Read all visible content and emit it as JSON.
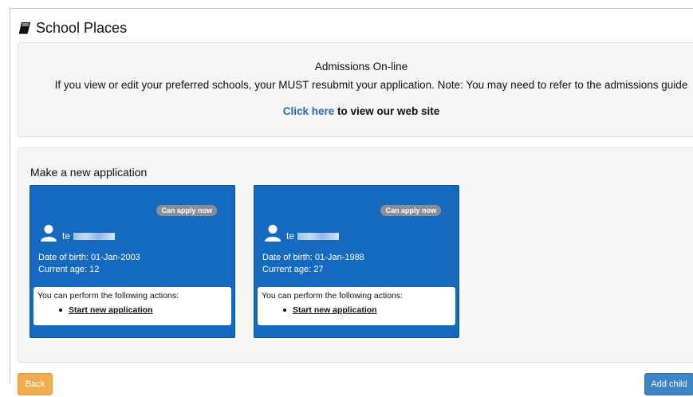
{
  "header": {
    "title": "School Places"
  },
  "info": {
    "title": "Admissions On-line",
    "body": "If you view or edit your preferred schools, your MUST resubmit your application. Note: You may need to refer to the admissions guide",
    "link_text": "Click here",
    "link_suffix": " to view our web site"
  },
  "applications": {
    "title": "Make a new application",
    "children": [
      {
        "badge": "Can apply now",
        "name_visible": "te",
        "dob": "Date of birth: 01-Jan-2003",
        "age": "Current age: 12",
        "actions_label": "You can perform the following actions:",
        "action": "Start new application"
      },
      {
        "badge": "Can apply now",
        "name_visible": "te",
        "dob": "Date of birth: 01-Jan-1988",
        "age": "Current age: 27",
        "actions_label": "You can perform the following actions:",
        "action": "Start new application"
      }
    ]
  },
  "buttons": {
    "back": "Back",
    "add_child": "Add child"
  },
  "colors": {
    "card_blue": "#1569be",
    "link_blue": "#2a6bb0",
    "back_orange": "#f0ad4e",
    "add_blue": "#3d85c6",
    "badge_grey": "#8a8f96"
  }
}
